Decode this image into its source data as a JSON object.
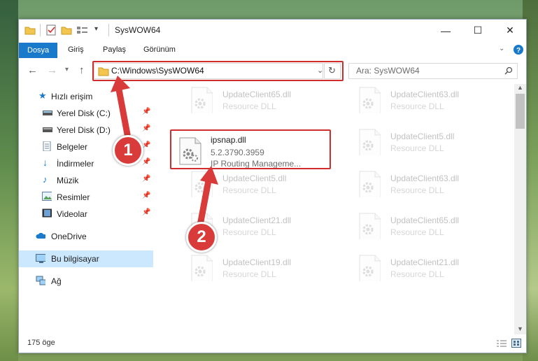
{
  "window": {
    "title": "SysWOW64",
    "minimize_glyph": "—",
    "maximize_glyph": "☐",
    "close_glyph": "✕"
  },
  "ribbon": {
    "tabs": [
      {
        "label": "Dosya",
        "active": true
      },
      {
        "label": "Giriş"
      },
      {
        "label": "Paylaş"
      },
      {
        "label": "Görünüm"
      }
    ]
  },
  "address": {
    "path": "C:\\Windows\\SysWOW64"
  },
  "search": {
    "placeholder": "Ara: SysWOW64"
  },
  "sidebar": {
    "items": [
      {
        "label": "Hızlı erişim",
        "icon": "star-icon",
        "pinned": false
      },
      {
        "label": "Yerel Disk (C:)",
        "icon": "drive-icon",
        "pinned": true
      },
      {
        "label": "Yerel Disk (D:)",
        "icon": "drive-icon",
        "pinned": true
      },
      {
        "label": "Belgeler",
        "icon": "document-icon",
        "pinned": true
      },
      {
        "label": "İndirmeler",
        "icon": "download-icon",
        "pinned": true
      },
      {
        "label": "Müzik",
        "icon": "music-icon",
        "pinned": true
      },
      {
        "label": "Resimler",
        "icon": "pictures-icon",
        "pinned": true
      },
      {
        "label": "Videolar",
        "icon": "video-icon",
        "pinned": true
      },
      {
        "label": "OneDrive",
        "icon": "cloud-icon"
      },
      {
        "label": "Bu bilgisayar",
        "icon": "computer-icon",
        "selected": true
      },
      {
        "label": "Ağ",
        "icon": "network-icon"
      }
    ]
  },
  "files": [
    {
      "name": "UpdateClient65.dll",
      "type": "Resource DLL"
    },
    {
      "name": "UpdateClient63.dll",
      "type": "Resource DLL"
    },
    {
      "name": "UpdateClient5.dll",
      "type": "Resource DLL"
    },
    {
      "name": "UpdateClient5.dll",
      "type": "Resource DLL"
    },
    {
      "name": "UpdateClient63.dll",
      "type": "Resource DLL"
    },
    {
      "name": "UpdateClient21.dll",
      "type": "Resource DLL"
    },
    {
      "name": "UpdateClient65.dll",
      "type": "Resource DLL"
    },
    {
      "name": "UpdateClient19.dll",
      "type": "Resource DLL"
    },
    {
      "name": "UpdateClient21.dll",
      "type": "Resource DLL"
    }
  ],
  "highlighted_file": {
    "name": "ipsnap.dll",
    "version": "5.2.3790.3959",
    "description": "IP Routing Manageme..."
  },
  "status": {
    "item_count": "175 öge"
  },
  "annotations": {
    "step1": "1",
    "step2": "2",
    "color": "#d93a3a"
  }
}
